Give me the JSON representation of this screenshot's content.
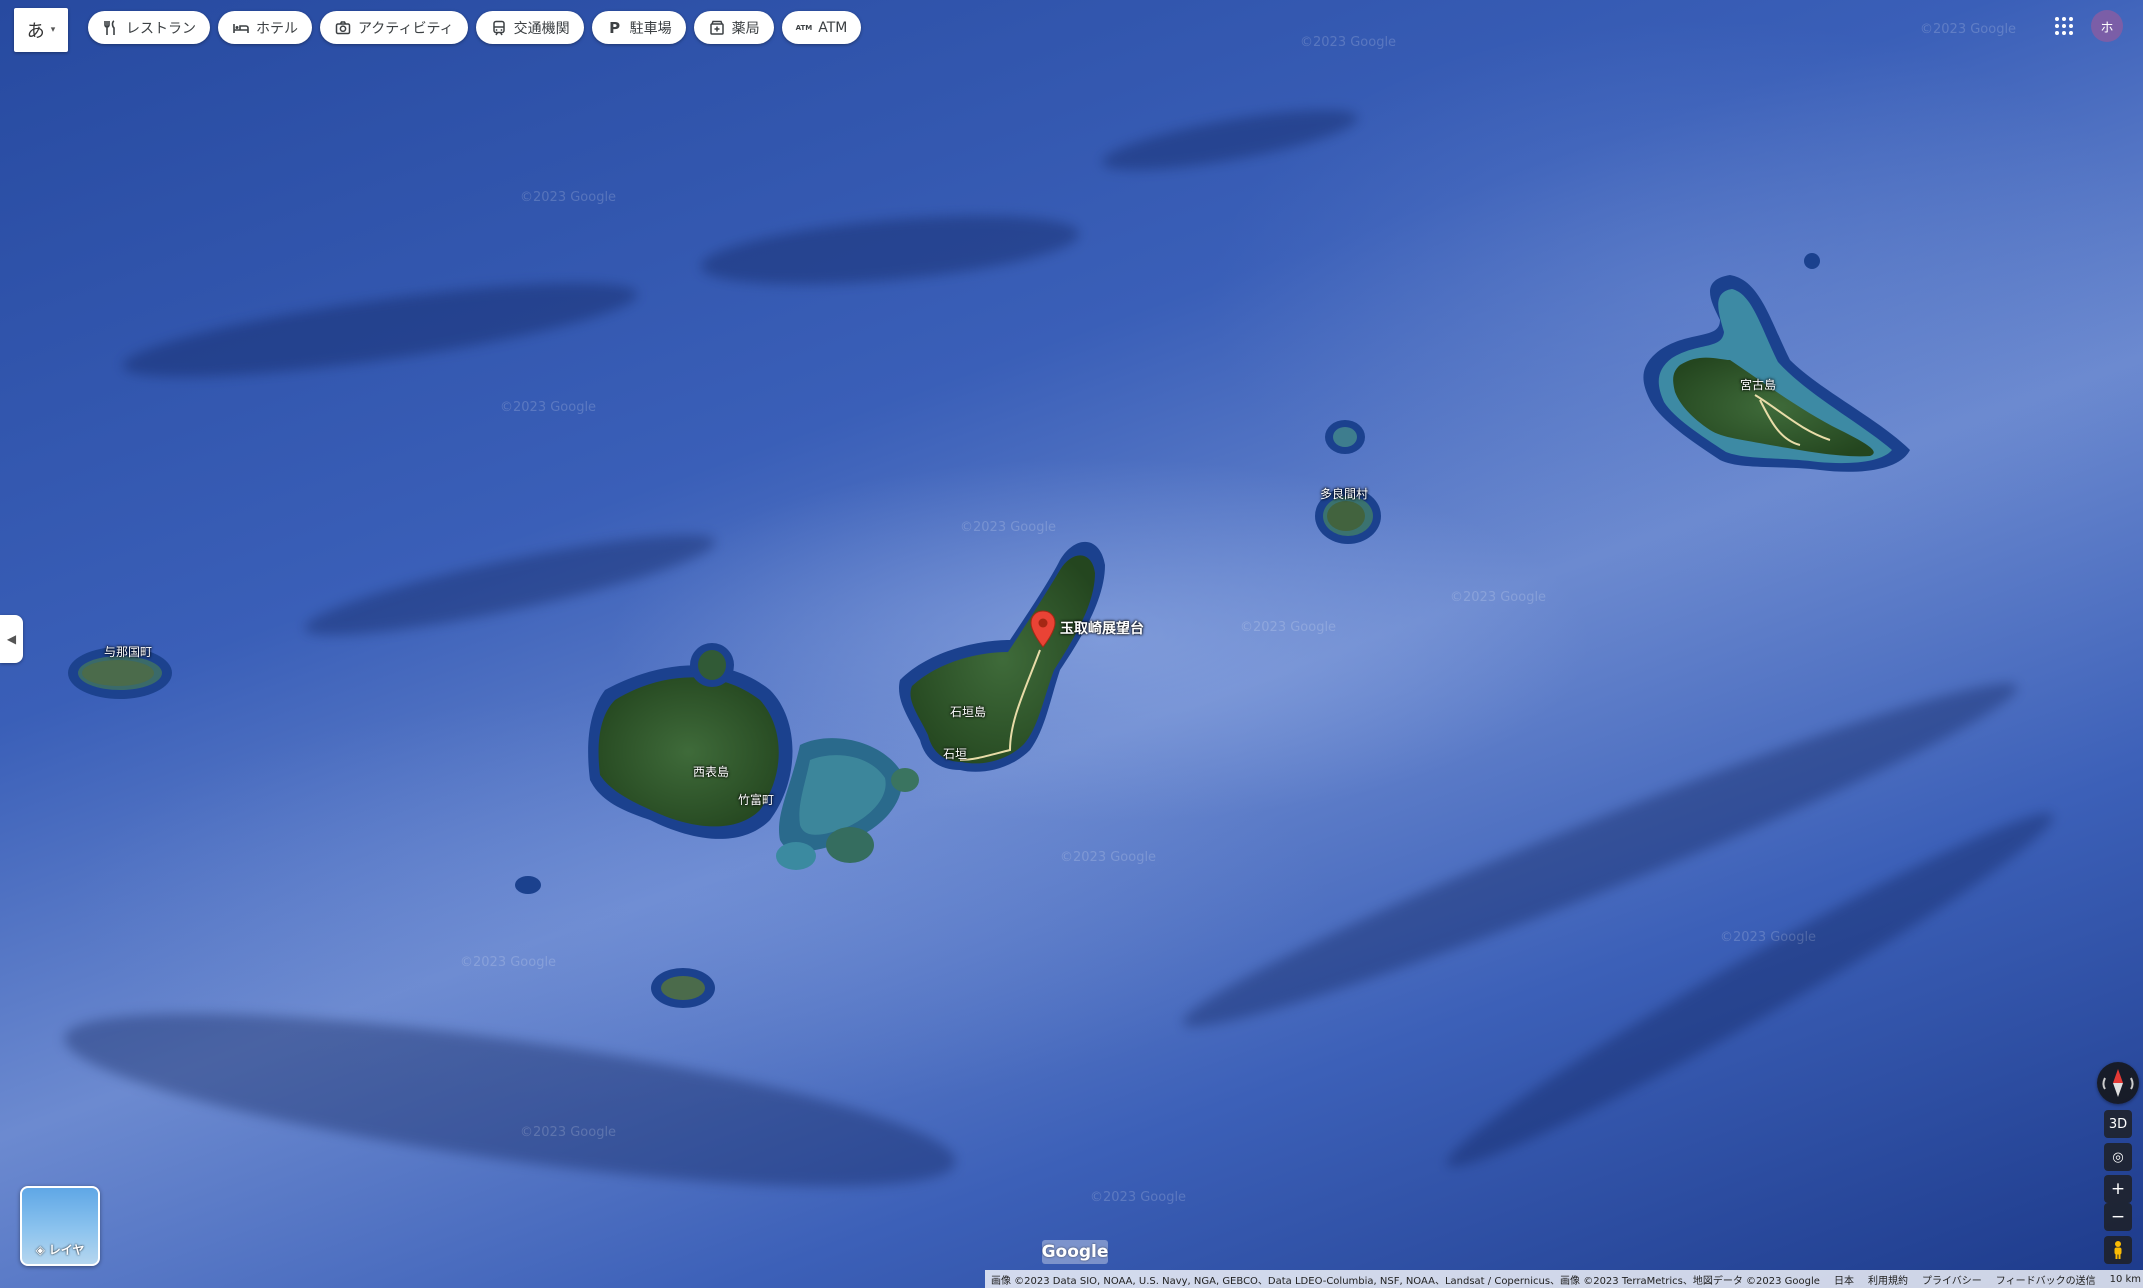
{
  "ime": {
    "label": "あ"
  },
  "chips": [
    {
      "icon": "fork-knife-icon",
      "label": "レストラン"
    },
    {
      "icon": "bed-icon",
      "label": "ホテル"
    },
    {
      "icon": "camera-icon",
      "label": "アクティビティ"
    },
    {
      "icon": "train-icon",
      "label": "交通機関"
    },
    {
      "icon": "parking-icon",
      "label": "駐車場"
    },
    {
      "icon": "pharmacy-icon",
      "label": "薬局"
    },
    {
      "icon": "atm-icon",
      "label": "ATM",
      "prefix": "ATM"
    }
  ],
  "account": {
    "initial": "ホ"
  },
  "map": {
    "marker": {
      "label": "玉取崎展望台",
      "color": "#ea4335"
    },
    "labels": {
      "yonaguni": "与那国町",
      "iriomote": "西表島",
      "taketomi": "竹富町",
      "ishigaki_island": "石垣島",
      "ishigaki_city": "石垣",
      "tarama": "多良間村",
      "miyako": "宮古島"
    },
    "watermark": "©2023 Google"
  },
  "layers": {
    "label": "レイヤ"
  },
  "controls": {
    "three_d": "3D",
    "zoom_in": "+",
    "zoom_out": "−"
  },
  "logo": "Google",
  "footer": {
    "attribution": "画像 ©2023 Data SIO, NOAA, U.S. Navy, NGA, GEBCO、Data LDEO-Columbia, NSF, NOAA、Landsat / Copernicus、画像 ©2023 TerraMetrics、地図データ ©2023 Google",
    "country": "日本",
    "terms": "利用規約",
    "privacy": "プライバシー",
    "feedback": "フィードバックの送信",
    "scale": "10 km"
  }
}
